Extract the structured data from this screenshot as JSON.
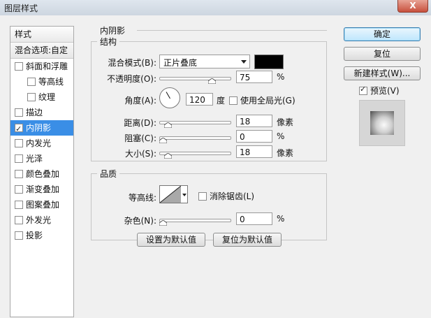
{
  "window": {
    "title": "图层样式",
    "close_label": "X"
  },
  "left_panel": {
    "header": "样式",
    "blend_options": "混合选项:自定",
    "items": [
      {
        "label": "斜面和浮雕",
        "checked": false,
        "sub": false,
        "active": false
      },
      {
        "label": "等高线",
        "checked": false,
        "sub": true,
        "active": false
      },
      {
        "label": "纹理",
        "checked": false,
        "sub": true,
        "active": false
      },
      {
        "label": "描边",
        "checked": false,
        "sub": false,
        "active": false
      },
      {
        "label": "内阴影",
        "checked": true,
        "sub": false,
        "active": true
      },
      {
        "label": "内发光",
        "checked": false,
        "sub": false,
        "active": false
      },
      {
        "label": "光泽",
        "checked": false,
        "sub": false,
        "active": false
      },
      {
        "label": "颜色叠加",
        "checked": false,
        "sub": false,
        "active": false
      },
      {
        "label": "渐变叠加",
        "checked": false,
        "sub": false,
        "active": false
      },
      {
        "label": "图案叠加",
        "checked": false,
        "sub": false,
        "active": false
      },
      {
        "label": "外发光",
        "checked": false,
        "sub": false,
        "active": false
      },
      {
        "label": "投影",
        "checked": false,
        "sub": false,
        "active": false
      }
    ]
  },
  "inner_shadow": {
    "title": "内阴影",
    "structure": {
      "title": "结构",
      "blend_mode_label": "混合模式(B):",
      "blend_mode_value": "正片叠底",
      "color": "#000000",
      "opacity_label": "不透明度(O):",
      "opacity_value": "75",
      "opacity_unit": "%",
      "opacity_fraction": 0.75,
      "angle_label": "角度(A):",
      "angle_value": "120",
      "angle_unit": "度",
      "global_light_label": "使用全局光(G)",
      "global_light_checked": false,
      "distance_label": "距离(D):",
      "distance_value": "18",
      "distance_unit": "像素",
      "distance_fraction": 0.07,
      "choke_label": "阻塞(C):",
      "choke_value": "0",
      "choke_unit": "%",
      "choke_fraction": 0.0,
      "size_label": "大小(S):",
      "size_value": "18",
      "size_unit": "像素",
      "size_fraction": 0.07
    },
    "quality": {
      "title": "品质",
      "contour_label": "等高线:",
      "antialias_label": "消除锯齿(L)",
      "antialias_checked": false,
      "noise_label": "杂色(N):",
      "noise_value": "0",
      "noise_unit": "%",
      "noise_fraction": 0.0
    },
    "set_default_label": "设置为默认值",
    "reset_default_label": "复位为默认值"
  },
  "right_panel": {
    "ok_label": "确定",
    "reset_label": "复位",
    "new_style_label": "新建样式(W)...",
    "preview_label": "预览(V)",
    "preview_checked": true
  }
}
